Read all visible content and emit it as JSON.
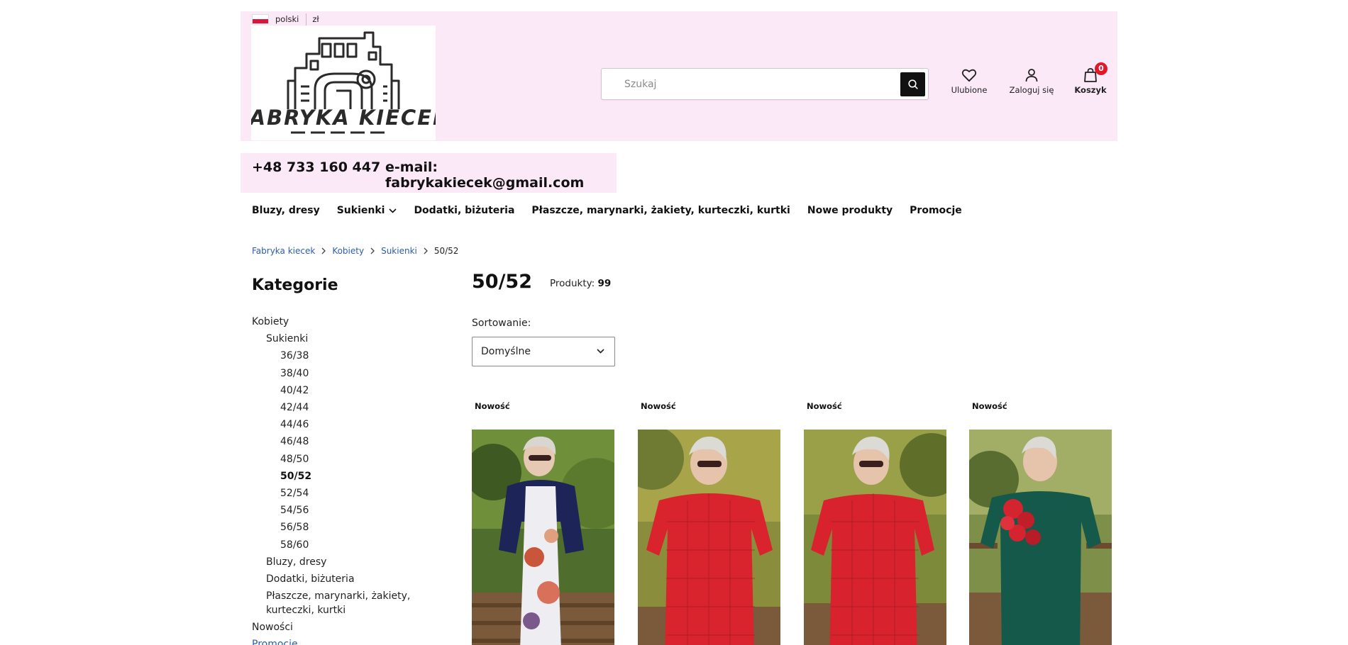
{
  "header": {
    "language": "polski",
    "currency": "zł",
    "logo_text": "FABRYKA KIECEK",
    "search_placeholder": "Szukaj",
    "favorites_label": "Ulubione",
    "login_label": "Zaloguj się",
    "cart_label": "Koszyk",
    "cart_count": "0"
  },
  "contact": {
    "phone": "+48 733 160 447",
    "email": "e-mail: fabrykakiecek@gmail.com"
  },
  "nav": {
    "items": [
      {
        "label": "Bluzy, dresy"
      },
      {
        "label": "Sukienki"
      },
      {
        "label": "Dodatki, biżuteria"
      },
      {
        "label": "Płaszcze, marynarki, żakiety, kurteczki, kurtki"
      },
      {
        "label": "Nowe produkty"
      },
      {
        "label": "Promocje"
      }
    ]
  },
  "breadcrumb": [
    "Fabryka kiecek",
    "Kobiety",
    "Sukienki",
    "50/52"
  ],
  "sidebar": {
    "title": "Kategorie",
    "items": [
      {
        "label": "Kobiety"
      },
      {
        "label": "Sukienki"
      },
      {
        "label": "36/38"
      },
      {
        "label": "38/40"
      },
      {
        "label": "40/42"
      },
      {
        "label": "42/44"
      },
      {
        "label": "44/46"
      },
      {
        "label": "46/48"
      },
      {
        "label": "48/50"
      },
      {
        "label": "50/52"
      },
      {
        "label": "52/54"
      },
      {
        "label": "54/56"
      },
      {
        "label": "56/58"
      },
      {
        "label": "58/60"
      },
      {
        "label": "Bluzy, dresy"
      },
      {
        "label": "Dodatki, biżuteria"
      },
      {
        "label": "Płaszcze, marynarki, żakiety, kurteczki, kurtki"
      },
      {
        "label": "Nowości"
      },
      {
        "label": "Promocje"
      }
    ]
  },
  "main": {
    "title": "50/52",
    "products_label": "Produkty:",
    "products_count": "99",
    "sort_label": "Sortowanie:",
    "sort_value": "Domyślne",
    "products": [
      {
        "tag": "Nowość"
      },
      {
        "tag": "Nowość"
      },
      {
        "tag": "Nowość"
      },
      {
        "tag": "Nowość"
      }
    ]
  },
  "colors": {
    "header_bg": "#fce9f8",
    "link": "#2a5db0",
    "badge": "#e0192a"
  }
}
